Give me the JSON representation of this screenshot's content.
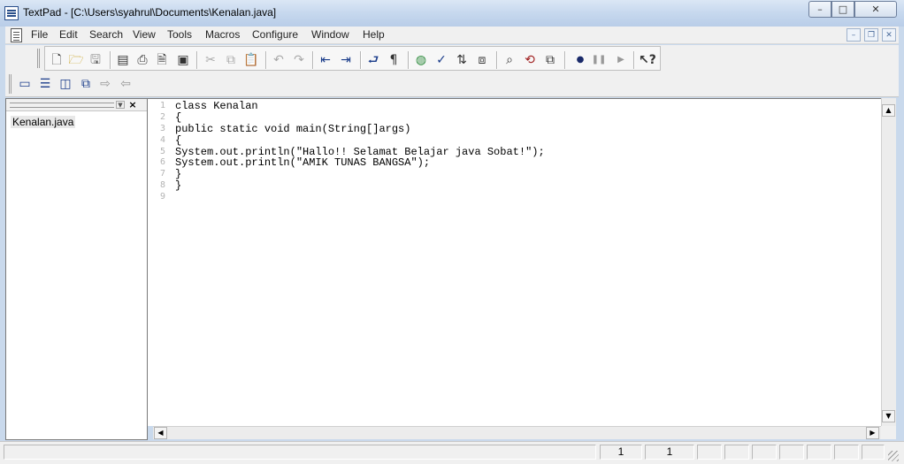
{
  "window": {
    "title": "TextPad - [C:\\Users\\syahrul\\Documents\\Kenalan.java]",
    "min_glyph": "–",
    "max_glyph": "□",
    "close_glyph": "✕"
  },
  "menu": {
    "items": [
      "File",
      "Edit",
      "Search",
      "View",
      "Tools",
      "Macros",
      "Configure",
      "Window",
      "Help"
    ],
    "mdi": {
      "min": "–",
      "restore": "❐",
      "close": "✕"
    }
  },
  "toolbar": {
    "main_icons": [
      "new-file-icon",
      "open-folder-icon",
      "save-icon",
      "manage-files-icon",
      "print-icon",
      "print-preview-icon",
      "document-properties-icon",
      "cut-icon",
      "copy-icon",
      "paste-icon",
      "undo-icon",
      "redo-icon",
      "indent-icon",
      "outdent-icon",
      "word-wrap-icon",
      "visible-spaces-icon",
      "web-browser-icon",
      "spell-check-icon",
      "sort-icon",
      "compare-icon",
      "find-icon",
      "replace-icon",
      "find-in-files-icon",
      "record-macro-icon",
      "play-macro-icon",
      "next-icon",
      "context-help-icon"
    ],
    "window_icons": [
      "cascade-icon",
      "tile-horizontal-icon",
      "tile-vertical-icon",
      "arrange-icon",
      "next-window-icon",
      "previous-window-icon"
    ]
  },
  "document_selector": {
    "files": [
      "Kenalan.java"
    ]
  },
  "editor": {
    "line_numbers": [
      "1",
      "2",
      "3",
      "4",
      "5",
      "6",
      "7",
      "8",
      "9"
    ],
    "lines": [
      "class Kenalan",
      "{",
      "public static void main(String[]args)",
      "{",
      "System.out.println(\"Hallo!! Selamat Belajar java Sobat!\");",
      "System.out.println(\"AMIK TUNAS BANGSA\");",
      "}",
      "}",
      ""
    ]
  },
  "status": {
    "line": "1",
    "column": "1"
  }
}
